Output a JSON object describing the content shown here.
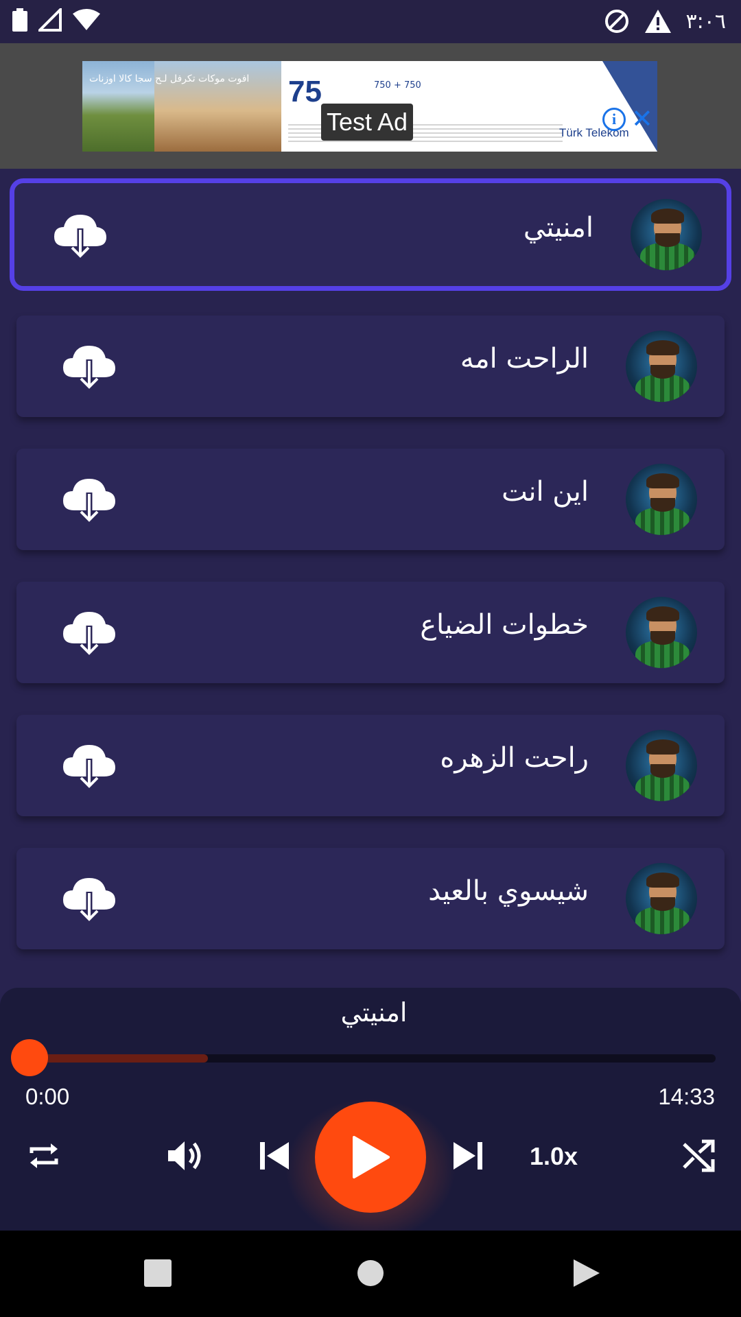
{
  "status_bar": {
    "time": "٣:٠٦"
  },
  "ad": {
    "label": "Test Ad",
    "headline_number": "75",
    "banner_text": "افوت موكات تكرفل لـح سجا كالا اوزنات",
    "offer_text": "750 + 750",
    "brand": "Türk Telekom",
    "info_glyph": "i",
    "close_glyph": "✕"
  },
  "tracks": [
    {
      "title": "امنيتي",
      "active": true
    },
    {
      "title": "الراحت امه",
      "active": false
    },
    {
      "title": "اين انت",
      "active": false
    },
    {
      "title": "خطوات الضياع",
      "active": false
    },
    {
      "title": "راحت الزهره",
      "active": false
    },
    {
      "title": "شيسوي بالعيد",
      "active": false
    }
  ],
  "player": {
    "now_playing": "امنيتي",
    "current_time": "0:00",
    "duration": "14:33",
    "progress_fraction": 0.0,
    "buffered_fraction": 0.26,
    "speed": "1.0x"
  },
  "colors": {
    "background": "#28234f",
    "accent": "#ff4a0f",
    "active_border": "#5540e6"
  },
  "icons": {
    "download": "cloud-download-icon",
    "repeat": "repeat-icon",
    "volume": "volume-icon",
    "previous": "skip-previous-icon",
    "play": "play-icon",
    "next": "skip-next-icon",
    "shuffle": "shuffle-icon"
  }
}
